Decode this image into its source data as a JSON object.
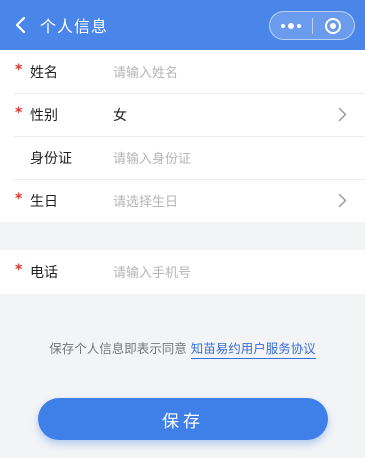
{
  "header": {
    "title": "个人信息",
    "background_color": "#4a86ea"
  },
  "form": {
    "fields": [
      {
        "label": "姓名",
        "required": true,
        "required_mark": "*",
        "placeholder": "请输入姓名",
        "value": ""
      },
      {
        "label": "性别",
        "required": true,
        "required_mark": "*",
        "placeholder": "",
        "value": "女"
      },
      {
        "label": "身份证",
        "required": false,
        "placeholder": "请输入身份证",
        "value": ""
      },
      {
        "label": "生日",
        "required": true,
        "required_mark": "*",
        "placeholder": "请选择生日",
        "value": ""
      }
    ],
    "phone": {
      "label": "电话",
      "required": true,
      "required_mark": "*",
      "placeholder": "请输入手机号",
      "value": ""
    }
  },
  "agreement": {
    "text": "保存个人信息即表示同意",
    "link_label": "知苗易约用户服务协议"
  },
  "save_button": {
    "label": "保存",
    "color": "#3f7fe8"
  },
  "colors": {
    "required": "#e0352b",
    "link": "#3a6fd8"
  }
}
